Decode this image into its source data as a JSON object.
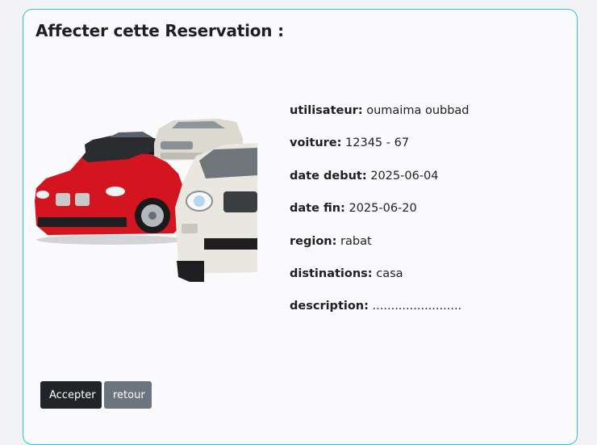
{
  "page": {
    "title": "Affecter cette Reservation :"
  },
  "reservation": {
    "fields": [
      {
        "label": "utilisateur:",
        "value": "oumaima oubbad"
      },
      {
        "label": "voiture:",
        "value": "12345 - 67"
      },
      {
        "label": "date debut:",
        "value": "2025-06-04"
      },
      {
        "label": "date fin:",
        "value": "2025-06-20"
      },
      {
        "label": "region:",
        "value": "rabat"
      },
      {
        "label": "distinations:",
        "value": "casa"
      },
      {
        "label": "description:",
        "value": "........................"
      }
    ]
  },
  "actions": {
    "accept_label": "Accepter",
    "back_label": "retour"
  },
  "colors": {
    "card_border": "#2ec4d6",
    "accept_button": "#212529",
    "back_button": "#6c757d",
    "car_red": "#d4141f",
    "car_white": "#e9e7e0",
    "car_black": "#2a2c2f"
  }
}
